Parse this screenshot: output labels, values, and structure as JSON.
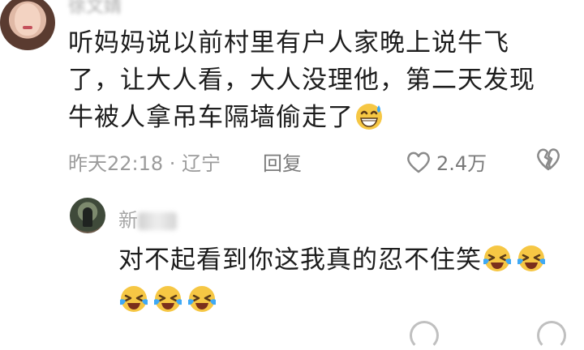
{
  "comment": {
    "username": "徐文婧",
    "text": "听妈妈说以前村里有户人家晚上说牛飞了，让大人看，大人没理他，第二天发现牛被人拿吊车隔墙偷走了",
    "emoji": "grinning-sweat-emoji",
    "time_location": "昨天22:18 · 辽宁",
    "reply_label": "回复",
    "like_count": "2.4万"
  },
  "reply": {
    "username": "新",
    "text": "对不起看到你这我真的忍不住笑",
    "emojis": [
      "laughing-tears-emoji",
      "laughing-tears-emoji",
      "laughing-tears-emoji",
      "laughing-tears-emoji",
      "laughing-tears-emoji"
    ]
  },
  "colors": {
    "text": "#1d1d1d",
    "meta": "#9b9b9b",
    "emoji_face": "#f6c744",
    "tear": "#3fa9f5"
  }
}
